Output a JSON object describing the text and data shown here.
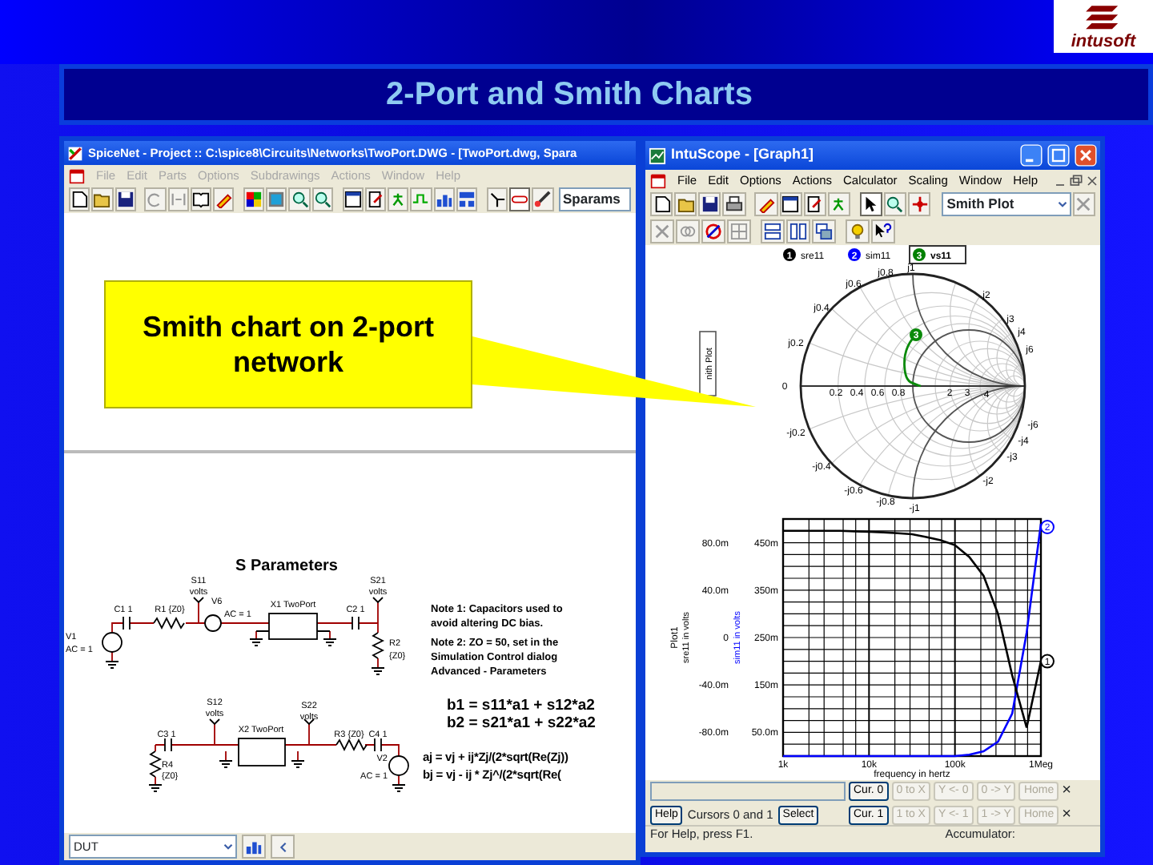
{
  "slide": {
    "title": "2-Port and Smith Charts",
    "logo": "intusoft"
  },
  "callout": {
    "text": "Smith chart on 2-port network"
  },
  "spicenet": {
    "title": "SpiceNet - Project :: C:\\spice8\\Circuits\\Networks\\TwoPort.DWG - [TwoPort.dwg, Spara",
    "menu": [
      {
        "label": "File",
        "disabled": true
      },
      {
        "label": "Edit",
        "disabled": true
      },
      {
        "label": "Parts",
        "disabled": true
      },
      {
        "label": "Options",
        "disabled": true
      },
      {
        "label": "Subdrawings",
        "disabled": true
      },
      {
        "label": "Actions",
        "disabled": true
      },
      {
        "label": "Window",
        "disabled": true
      },
      {
        "label": "Help",
        "disabled": true
      }
    ],
    "scenario_combo": "Sparams",
    "schematic": {
      "title": "S Parameters",
      "labels": [
        "V1",
        "AC = 1",
        "C1 1",
        "R1 {Z0}",
        "S11",
        "volts",
        "V6",
        "AC = 1",
        "X1 TwoPort",
        "C2 1",
        "S21",
        "volts",
        "R2",
        "{Z0}",
        "S12",
        "volts",
        "X2 TwoPort",
        "S22",
        "volts",
        "C3 1",
        "R3 {Z0}",
        "C4 1",
        "R4",
        "{Z0}",
        "V2",
        "AC = 1"
      ],
      "notes": [
        [
          "Note 1: Capacitors used to",
          "avoid altering DC bias."
        ],
        [
          "Note 2: ZO = 50, set in the",
          "Simulation Control dialog",
          "Advanced - Parameters"
        ]
      ],
      "equations": [
        "b1 = s11*a1 + s12*a2",
        "b2 = s21*a1 + s22*a2",
        "aj = vj + ij*Zj/(2*sqrt(Re(Zj))",
        "bj = vj - ij * Zj^/(2*sqrt(Re("
      ]
    },
    "footer_combo": "DUT"
  },
  "intuscope": {
    "title": "IntuScope - [Graph1]",
    "menu": [
      {
        "label": "File",
        "disabled": false
      },
      {
        "label": "Edit",
        "disabled": false
      },
      {
        "label": "Options",
        "disabled": false
      },
      {
        "label": "Actions",
        "disabled": false
      },
      {
        "label": "Calculator",
        "disabled": false
      },
      {
        "label": "Scaling",
        "disabled": false
      },
      {
        "label": "Window",
        "disabled": false
      },
      {
        "label": "Help",
        "disabled": false
      }
    ],
    "plot_combo": "Smith Plot",
    "legend": [
      {
        "number": "1",
        "name": "sre11",
        "color": "#000000",
        "selected": false
      },
      {
        "number": "2",
        "name": "sim11",
        "color": "#0000ff",
        "selected": false
      },
      {
        "number": "3",
        "name": "vs11",
        "color": "#008000",
        "selected": true
      }
    ],
    "smith": {
      "side_label": "nith Plot",
      "axis_labels": [
        "0",
        "0.2",
        "0.4",
        "0.6",
        "0.8",
        "2",
        "3",
        "4",
        "j0.2",
        "j0.4",
        "j0.6",
        "j0.8",
        "j1",
        "j2",
        "j3",
        "j4",
        "j6",
        "-j0.2",
        "-j0.4",
        "-j0.6",
        "-j0.8",
        "-j1",
        "-j2",
        "-j3",
        "-j4",
        "-j6"
      ],
      "trace_marker": "3"
    },
    "plot": {
      "title": "Plot1",
      "secondary_ylabel": "sre11 in volts",
      "secondary_yticks": [
        "80.0m",
        "40.0m",
        "0",
        "-40.0m",
        "-80.0m"
      ],
      "end_markers": [
        "2",
        "1"
      ],
      "chart_data": {
        "type": "line",
        "xlabel": "frequency in hertz",
        "ylabel": "sim11 in volts",
        "categories": [
          "1k",
          null,
          null,
          null,
          null,
          null,
          "10k",
          null,
          null,
          null,
          null,
          null,
          "100k",
          null,
          null,
          null,
          null,
          null,
          "1Meg"
        ],
        "series": [
          {
            "color": "#0000ff",
            "values": [
              0,
              0,
              0,
              0,
              0,
              0,
              0,
              0,
              0,
              0,
              0,
              0,
              0,
              3,
              10,
              30,
              90,
              260,
              490
            ]
          },
          {
            "color": "#000000",
            "values": [
              475,
              475,
              475,
              475,
              475,
              474,
              473,
              472,
              470,
              468,
              462,
              455,
              445,
              420,
              380,
              300,
              170,
              60,
              200
            ]
          }
        ],
        "ylim": [
          0,
          500
        ],
        "grid": true,
        "yticks": [
          {
            "value": 450,
            "label": "450m"
          },
          {
            "value": 350,
            "label": "350m"
          },
          {
            "value": 250,
            "label": "250m"
          },
          {
            "value": 150,
            "label": "150m"
          },
          {
            "value": 50,
            "label": "50.0m"
          }
        ]
      }
    },
    "cursor_panel": {
      "rows": [
        [
          {
            "kind": "field"
          },
          "",
          "",
          {
            "kind": "button",
            "label": "Cur. 0",
            "disabled": false
          },
          {
            "kind": "button",
            "label": "0 to X",
            "disabled": true
          },
          {
            "kind": "button",
            "label": "Y <- 0",
            "disabled": true
          },
          {
            "kind": "button",
            "label": "0 -> Y",
            "disabled": true
          },
          {
            "kind": "button",
            "label": "Home",
            "disabled": true
          },
          {
            "kind": "close",
            "label": "×"
          }
        ],
        [
          {
            "kind": "button",
            "label": "Help",
            "disabled": false
          },
          {
            "kind": "text",
            "label": "Cursors 0 and 1"
          },
          {
            "kind": "button",
            "label": "Select",
            "disabled": false
          },
          {
            "kind": "button",
            "label": "Cur. 1",
            "disabled": false
          },
          {
            "kind": "button",
            "label": "1 to X",
            "disabled": true
          },
          {
            "kind": "button",
            "label": "Y <- 1",
            "disabled": true
          },
          {
            "kind": "button",
            "label": "1 -> Y",
            "disabled": true
          },
          {
            "kind": "button",
            "label": "Home",
            "disabled": true
          },
          {
            "kind": "close",
            "label": "×"
          }
        ]
      ]
    },
    "status": [
      "For Help, press F1.",
      "Accumulator:"
    ]
  }
}
